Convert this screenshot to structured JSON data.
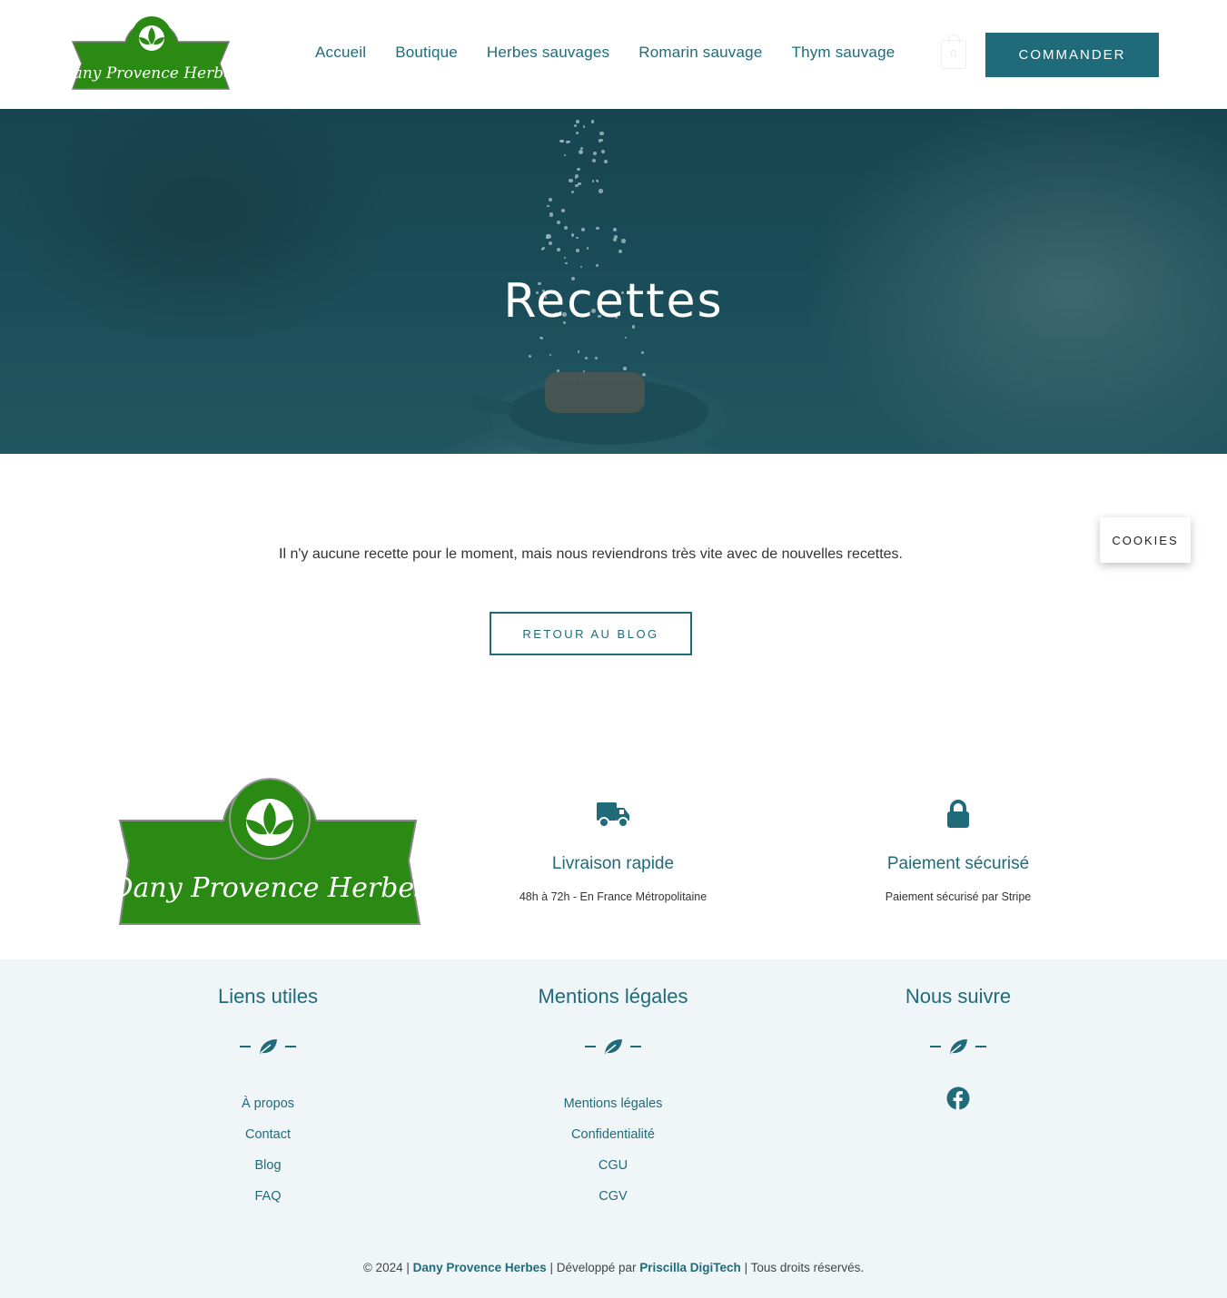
{
  "header": {
    "logo_text": "Dany Provence Herbes",
    "nav": [
      "Accueil",
      "Boutique",
      "Herbes sauvages",
      "Romarin sauvage",
      "Thym sauvage"
    ],
    "cart_count": "0",
    "cta_label": "COMMANDER"
  },
  "hero": {
    "title": "Recettes"
  },
  "main": {
    "empty_message": "Il n'y aucune recette pour le moment, mais nous reviendrons très vite avec de nouvelles recettes.",
    "back_button": "RETOUR AU BLOG"
  },
  "cookies_label": "COOKIES",
  "features": [
    {
      "icon": "truck-icon",
      "title": "Livraison rapide",
      "text": "48h à 72h - En France Métropolitaine"
    },
    {
      "icon": "lock-icon",
      "title": "Paiement sécurisé",
      "text": "Paiement sécurisé par Stripe"
    }
  ],
  "footer": {
    "col1": {
      "title": "Liens utiles",
      "links": [
        "À propos",
        "Contact",
        "Blog",
        "FAQ"
      ]
    },
    "col2": {
      "title": "Mentions légales",
      "links": [
        "Mentions légales",
        "Confidentialité",
        "CGU",
        "CGV"
      ]
    },
    "col3": {
      "title": "Nous suivre",
      "social_icon": "facebook-icon"
    },
    "copyright": {
      "prefix": "© 2024 | ",
      "brand": "Dany Provence Herbes",
      "middle": " | Développé par ",
      "dev": "Priscilla DigiTech",
      "suffix": " | Tous droits réservés."
    }
  },
  "colors": {
    "accent": "#1f6b7a",
    "logo_green": "#2a8a13",
    "footer_bg": "#f0f5f7"
  }
}
